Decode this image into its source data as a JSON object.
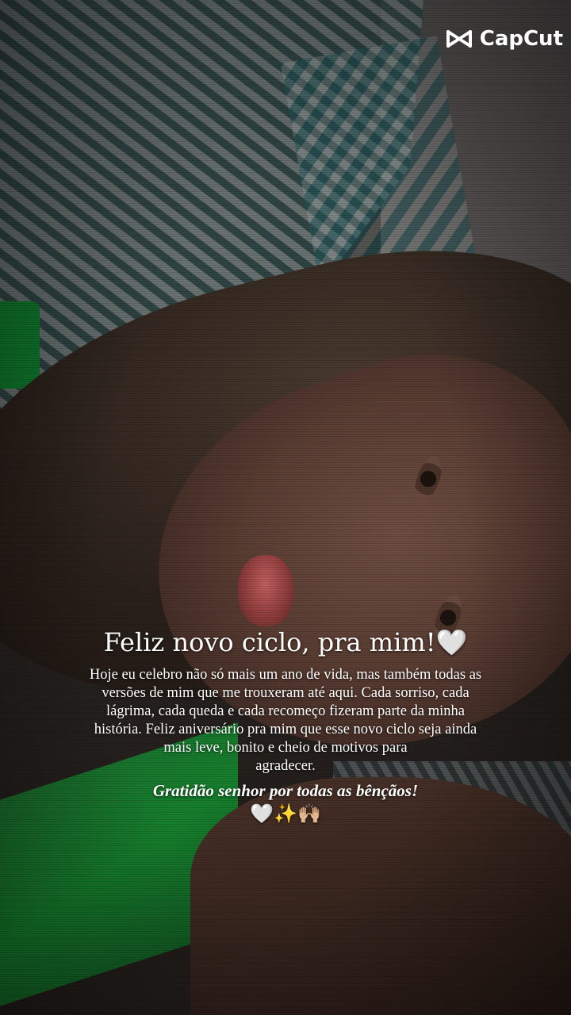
{
  "watermark": {
    "brand": "CapCut",
    "icon": "capcut-logo-icon"
  },
  "caption": {
    "title": "Feliz novo ciclo, pra mim!🤍",
    "body_lines": [
      "Hoje eu celebro não só mais um ano de vida, mas também todas as",
      "versões de mim que me trouxeram até aqui. Cada sorriso, cada",
      "lágrima, cada queda e cada recomeço fizeram parte da minha",
      "história. Feliz aniversário pra mim que esse novo ciclo seja ainda",
      "mais leve, bonito e cheio de motivos para",
      "agradecer."
    ],
    "gratitude": "Gratidão senhor por todas as bênçãos!",
    "emojis": "🤍✨🙌🏼"
  },
  "colors": {
    "text": "#ffffff",
    "shirt_green": "#148a2e"
  }
}
